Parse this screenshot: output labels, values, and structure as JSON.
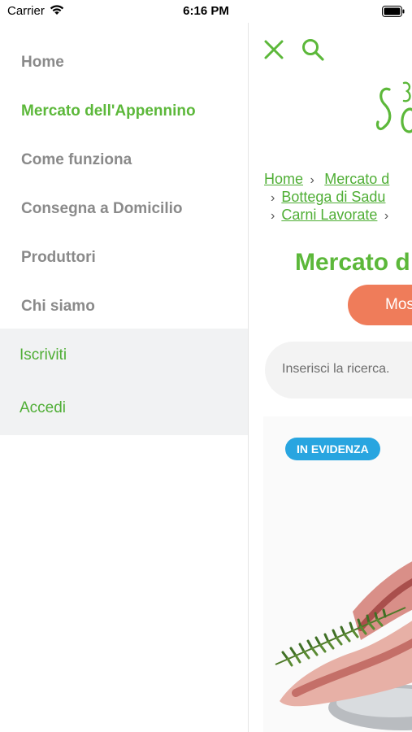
{
  "status_bar": {
    "carrier": "Carrier",
    "time": "6:16 PM"
  },
  "menu": {
    "items": [
      {
        "label": "Home",
        "active": false
      },
      {
        "label": "Mercato dell'Appennino",
        "active": true
      },
      {
        "label": "Come funziona",
        "active": false
      },
      {
        "label": "Consegna a Domicilio",
        "active": false
      },
      {
        "label": "Produttori",
        "active": false
      },
      {
        "label": "Chi siamo",
        "active": false
      }
    ],
    "register": "Iscriviti",
    "login": "Accedi"
  },
  "main": {
    "breadcrumb": {
      "home": "Home",
      "level1": "Mercato d",
      "level2": "Bottega di Sadu",
      "level3": "Carni Lavorate"
    },
    "title": "Mercato d",
    "show_button": "Mos",
    "search_placeholder": "Inserisci la ricerca.",
    "featured_badge": "IN EVIDENZA"
  },
  "colors": {
    "accent_green": "#5cb83a",
    "button_orange": "#ef7c5a",
    "badge_blue": "#28a5e0"
  }
}
